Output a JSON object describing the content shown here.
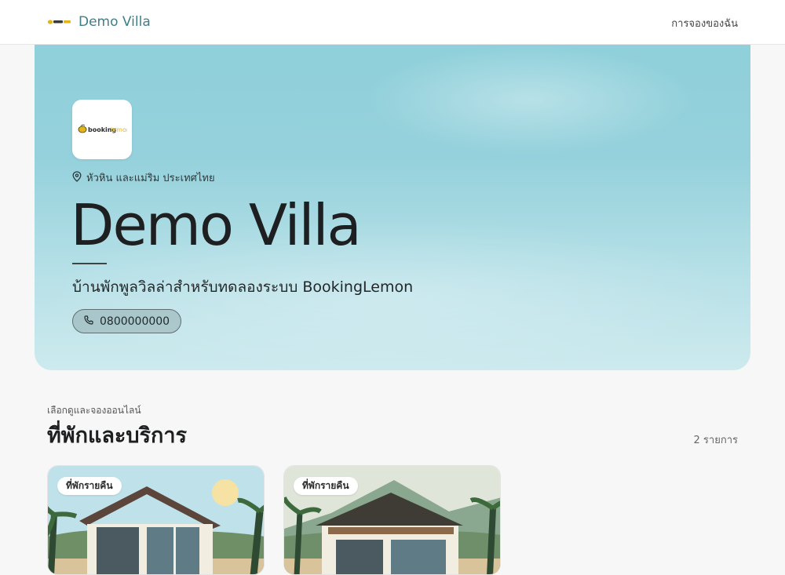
{
  "header": {
    "brand_title": "Demo Villa",
    "nav_my_bookings": "การจองของฉัน",
    "logo_icon": "bookinglemon-logo"
  },
  "hero": {
    "location": "หัวหิน และแม่ริม ประเทศไทย",
    "title": "Demo Villa",
    "subtitle": "บ้านพักพูลวิลล่าสำหรับทดลองระบบ BookingLemon",
    "phone": "0800000000",
    "logo_text_booking": "booking",
    "logo_text_lemon": "lemon",
    "colors": {
      "sky_top": "#8fd0da",
      "sky_bottom": "#cdeaee",
      "brand_teal": "#3f7f86",
      "lemon_yellow": "#e2b51a"
    }
  },
  "listings": {
    "kicker": "เลือกดูและจองออนไลน์",
    "title": "ที่พักและบริการ",
    "count": "2 รายการ",
    "items": [
      {
        "badge": "ที่พักรายคืน",
        "illustration": "beach-house"
      },
      {
        "badge": "ที่พักรายคืน",
        "illustration": "mountain-house"
      }
    ]
  }
}
